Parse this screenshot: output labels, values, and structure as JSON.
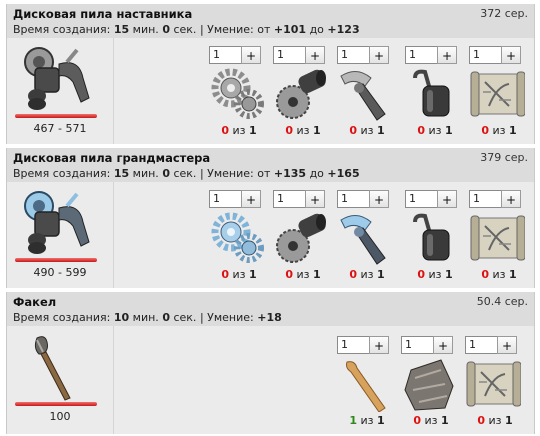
{
  "labels": {
    "time": "Время создания:",
    "skill": "Умение:",
    "sep": "|",
    "of": "из"
  },
  "recipes": [
    {
      "title": "Дисковая пила наставника",
      "price": "372 сер.",
      "time": {
        "min": "15",
        "min_unit": "мин.",
        "sec": "0",
        "sec_unit": "сек."
      },
      "skill": {
        "from_word": "от",
        "from": "+101",
        "to_word": "до",
        "to": "+123"
      },
      "range": "467 - 571",
      "tool_icon": "circular-saw-icon",
      "ingredients": [
        {
          "icon": "gears-icon",
          "qty": "1",
          "plus": "+",
          "have": "0",
          "need": "1"
        },
        {
          "icon": "saw-blade-roller-icon",
          "qty": "1",
          "plus": "+",
          "have": "0",
          "need": "1"
        },
        {
          "icon": "handle-icon",
          "qty": "1",
          "plus": "+",
          "have": "0",
          "need": "1"
        },
        {
          "icon": "weight-icon",
          "qty": "1",
          "plus": "+",
          "have": "0",
          "need": "1"
        },
        {
          "icon": "scroll-icon",
          "qty": "1",
          "plus": "+",
          "have": "0",
          "need": "1"
        }
      ]
    },
    {
      "title": "Дисковая пила грандмастера",
      "price": "379 сер.",
      "time": {
        "min": "15",
        "min_unit": "мин.",
        "sec": "0",
        "sec_unit": "сек."
      },
      "skill": {
        "from_word": "от",
        "from": "+135",
        "to_word": "до",
        "to": "+165"
      },
      "range": "490 - 599",
      "tool_icon": "circular-saw-blue-icon",
      "ingredients": [
        {
          "icon": "gears-blue-icon",
          "qty": "1",
          "plus": "+",
          "have": "0",
          "need": "1"
        },
        {
          "icon": "saw-blade-roller-icon",
          "qty": "1",
          "plus": "+",
          "have": "0",
          "need": "1"
        },
        {
          "icon": "handle-blue-icon",
          "qty": "1",
          "plus": "+",
          "have": "0",
          "need": "1"
        },
        {
          "icon": "weight-icon",
          "qty": "1",
          "plus": "+",
          "have": "0",
          "need": "1"
        },
        {
          "icon": "scroll-icon",
          "qty": "1",
          "plus": "+",
          "have": "0",
          "need": "1"
        }
      ]
    },
    {
      "title": "Факел",
      "price": "50.4 сер.",
      "time": {
        "min": "10",
        "min_unit": "мин.",
        "sec": "0",
        "sec_unit": "сек."
      },
      "skill": {
        "value": "+18"
      },
      "range": "100",
      "tool_icon": "torch-icon",
      "ingredients": [
        {
          "icon": "wooden-stick-icon",
          "qty": "1",
          "plus": "+",
          "have": "1",
          "need": "1",
          "ok": true
        },
        {
          "icon": "cloth-rag-icon",
          "qty": "1",
          "plus": "+",
          "have": "0",
          "need": "1"
        },
        {
          "icon": "scroll-icon",
          "qty": "1",
          "plus": "+",
          "have": "0",
          "need": "1"
        }
      ]
    }
  ]
}
